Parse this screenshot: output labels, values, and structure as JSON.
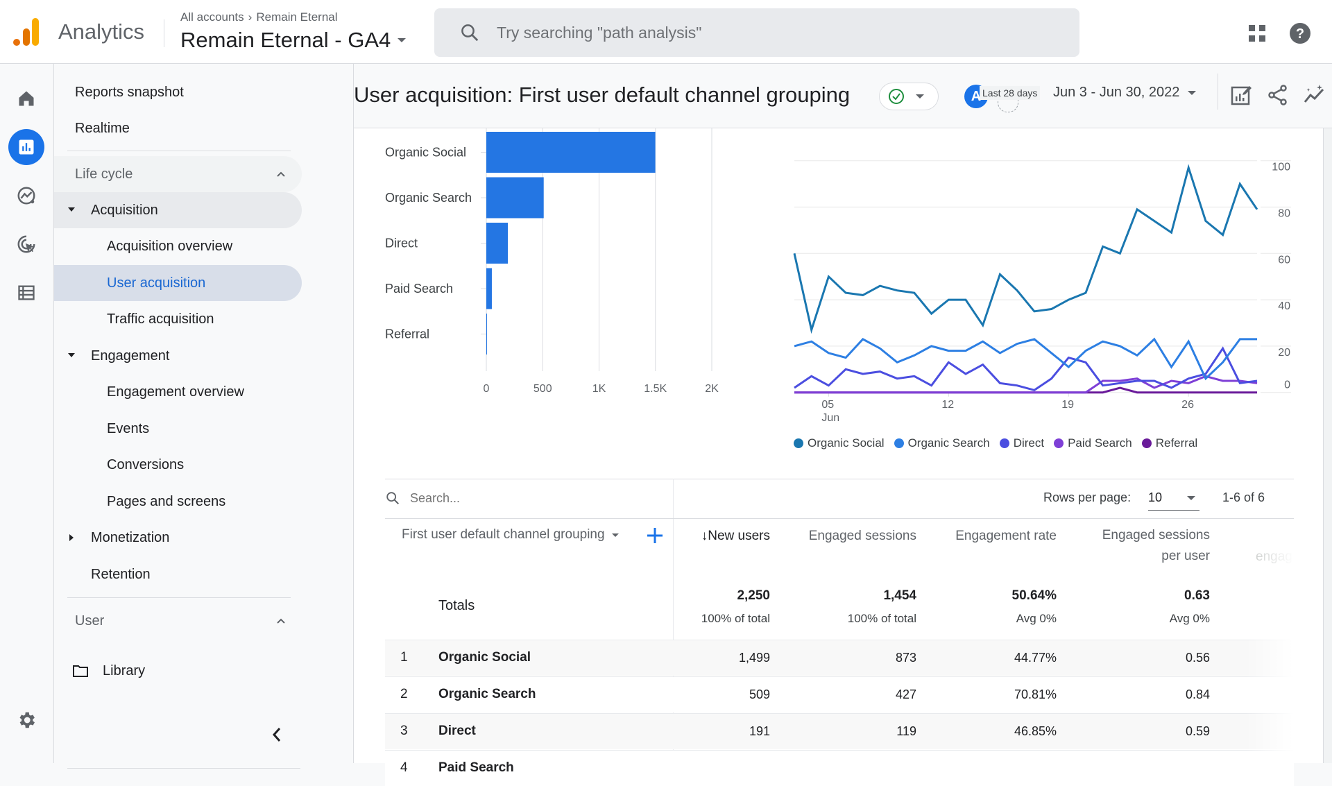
{
  "header": {
    "app_name": "Analytics",
    "breadcrumb": [
      "All accounts",
      "Remain Eternal"
    ],
    "breadcrumb_separator": "›",
    "property": "Remain Eternal - GA4",
    "search_placeholder": "Try searching \"path analysis\"",
    "icons": [
      "apps-grid-icon",
      "help-icon"
    ]
  },
  "rail": {
    "items": [
      {
        "name": "home",
        "icon": "home-icon"
      },
      {
        "name": "reports",
        "icon": "bar-chart-icon",
        "active": true
      },
      {
        "name": "explore",
        "icon": "explore-icon"
      },
      {
        "name": "advertising",
        "icon": "advertising-icon"
      },
      {
        "name": "configure",
        "icon": "list-icon"
      }
    ],
    "bottom_icon": "settings-gear-icon"
  },
  "nav": {
    "top_items": [
      "Reports snapshot",
      "Realtime"
    ],
    "lifecycle": {
      "label": "Life cycle",
      "groups": [
        {
          "label": "Acquisition",
          "expanded": true,
          "children": [
            "Acquisition overview",
            "User acquisition",
            "Traffic acquisition"
          ],
          "selected": "User acquisition"
        },
        {
          "label": "Engagement",
          "expanded": true,
          "children": [
            "Engagement overview",
            "Events",
            "Conversions",
            "Pages and screens"
          ]
        },
        {
          "label": "Monetization",
          "expanded": false,
          "children": []
        },
        {
          "label": "Retention",
          "expanded": false,
          "children": []
        }
      ]
    },
    "user_section": "User",
    "library": "Library"
  },
  "report": {
    "title": "User acquisition: First user default channel grouping",
    "compare_avatar": "A",
    "range_label": "Last 28 days",
    "date_range": "Jun 3 - Jun 30, 2022",
    "toolbar_icons": [
      "customize-report-icon",
      "share-icon",
      "insights-icon"
    ]
  },
  "colors": {
    "accent": "#1a73e8",
    "bar": "#2476e3",
    "organic_social": "#1a77b0",
    "organic_search": "#2d7fe3",
    "direct": "#4b4ee0",
    "paid_search": "#7e3fd6",
    "referral": "#6a1b9a",
    "status_ok": "#1e8e3e"
  },
  "chart_data": [
    {
      "type": "bar",
      "orientation": "horizontal",
      "title": "",
      "categories": [
        "Organic Social",
        "Organic Search",
        "Direct",
        "Paid Search",
        "Referral"
      ],
      "values": [
        1499,
        509,
        191,
        49,
        2
      ],
      "xlabel": "",
      "ylabel": "",
      "xlim": [
        0,
        2000
      ],
      "xticks": [
        "0",
        "500",
        "1K",
        "1.5K",
        "2K"
      ],
      "grid": true
    },
    {
      "type": "line",
      "title": "",
      "x": [
        "Jun 3",
        "Jun 4",
        "Jun 5",
        "Jun 6",
        "Jun 7",
        "Jun 8",
        "Jun 9",
        "Jun 10",
        "Jun 11",
        "Jun 12",
        "Jun 13",
        "Jun 14",
        "Jun 15",
        "Jun 16",
        "Jun 17",
        "Jun 18",
        "Jun 19",
        "Jun 20",
        "Jun 21",
        "Jun 22",
        "Jun 23",
        "Jun 24",
        "Jun 25",
        "Jun 26",
        "Jun 27",
        "Jun 28",
        "Jun 29",
        "Jun 30"
      ],
      "xticks": [
        {
          "day_index": 2,
          "label": "05",
          "sublabel": "Jun"
        },
        {
          "day_index": 9,
          "label": "12"
        },
        {
          "day_index": 16,
          "label": "19"
        },
        {
          "day_index": 23,
          "label": "26"
        }
      ],
      "yticks": [
        "0",
        "20",
        "40",
        "60",
        "80",
        "100"
      ],
      "ylim": [
        0,
        100
      ],
      "y_axis_side": "right",
      "grid": true,
      "legend": "bottom",
      "series": [
        {
          "name": "Organic Social",
          "values": [
            60,
            27,
            50,
            43,
            42,
            46,
            44,
            43,
            34,
            40,
            40,
            29,
            51,
            44,
            35,
            36,
            40,
            43,
            63,
            60,
            79,
            74,
            69,
            97,
            74,
            68,
            90,
            79
          ]
        },
        {
          "name": "Organic Search",
          "values": [
            20,
            22,
            17,
            15,
            23,
            19,
            13,
            16,
            20,
            18,
            18,
            22,
            17,
            21,
            23,
            17,
            11,
            18,
            22,
            20,
            16,
            23,
            11,
            22,
            6,
            13,
            23,
            23
          ]
        },
        {
          "name": "Direct",
          "values": [
            2,
            7,
            3,
            10,
            8,
            9,
            6,
            7,
            3,
            13,
            8,
            12,
            4,
            3,
            1,
            6,
            15,
            13,
            3,
            4,
            5,
            5,
            2,
            6,
            8,
            19,
            4,
            5
          ]
        },
        {
          "name": "Paid Search",
          "values": [
            0,
            0,
            0,
            0,
            0,
            0,
            0,
            0,
            0,
            0,
            0,
            0,
            0,
            0,
            0,
            0,
            0,
            0,
            5,
            5,
            6,
            2,
            5,
            4,
            7,
            5,
            5,
            4
          ]
        },
        {
          "name": "Referral",
          "values": [
            0,
            0,
            0,
            0,
            0,
            0,
            0,
            0,
            0,
            0,
            0,
            0,
            0,
            0,
            0,
            0,
            0,
            0,
            0,
            2,
            0,
            0,
            0,
            0,
            0,
            0,
            0,
            0
          ]
        }
      ]
    }
  ],
  "table": {
    "search_placeholder": "Search...",
    "rows_per_page_label": "Rows per page:",
    "rows_per_page": "10",
    "pagination": "1-6 of 6",
    "dimension_header": "First user default channel grouping",
    "columns": [
      {
        "label": "↓New users",
        "sorted": true
      },
      {
        "label": "Engaged sessions"
      },
      {
        "label": "Engagement rate"
      },
      {
        "label": "Engaged sessions",
        "label2": "per user"
      },
      {
        "label": "engag",
        "faded": true
      }
    ],
    "totals": {
      "label": "Totals",
      "values": [
        "2,250",
        "1,454",
        "50.64%",
        "0.63"
      ],
      "subvalues": [
        "100% of total",
        "100% of total",
        "Avg 0%",
        "Avg 0%"
      ]
    },
    "rows": [
      {
        "rank": "1",
        "channel": "Organic Social",
        "values": [
          "1,499",
          "873",
          "44.77%",
          "0.56"
        ]
      },
      {
        "rank": "2",
        "channel": "Organic Search",
        "values": [
          "509",
          "427",
          "70.81%",
          "0.84"
        ]
      },
      {
        "rank": "3",
        "channel": "Direct",
        "values": [
          "191",
          "119",
          "46.85%",
          "0.59"
        ]
      },
      {
        "rank": "4",
        "channel": "Paid Search",
        "values": []
      }
    ]
  }
}
